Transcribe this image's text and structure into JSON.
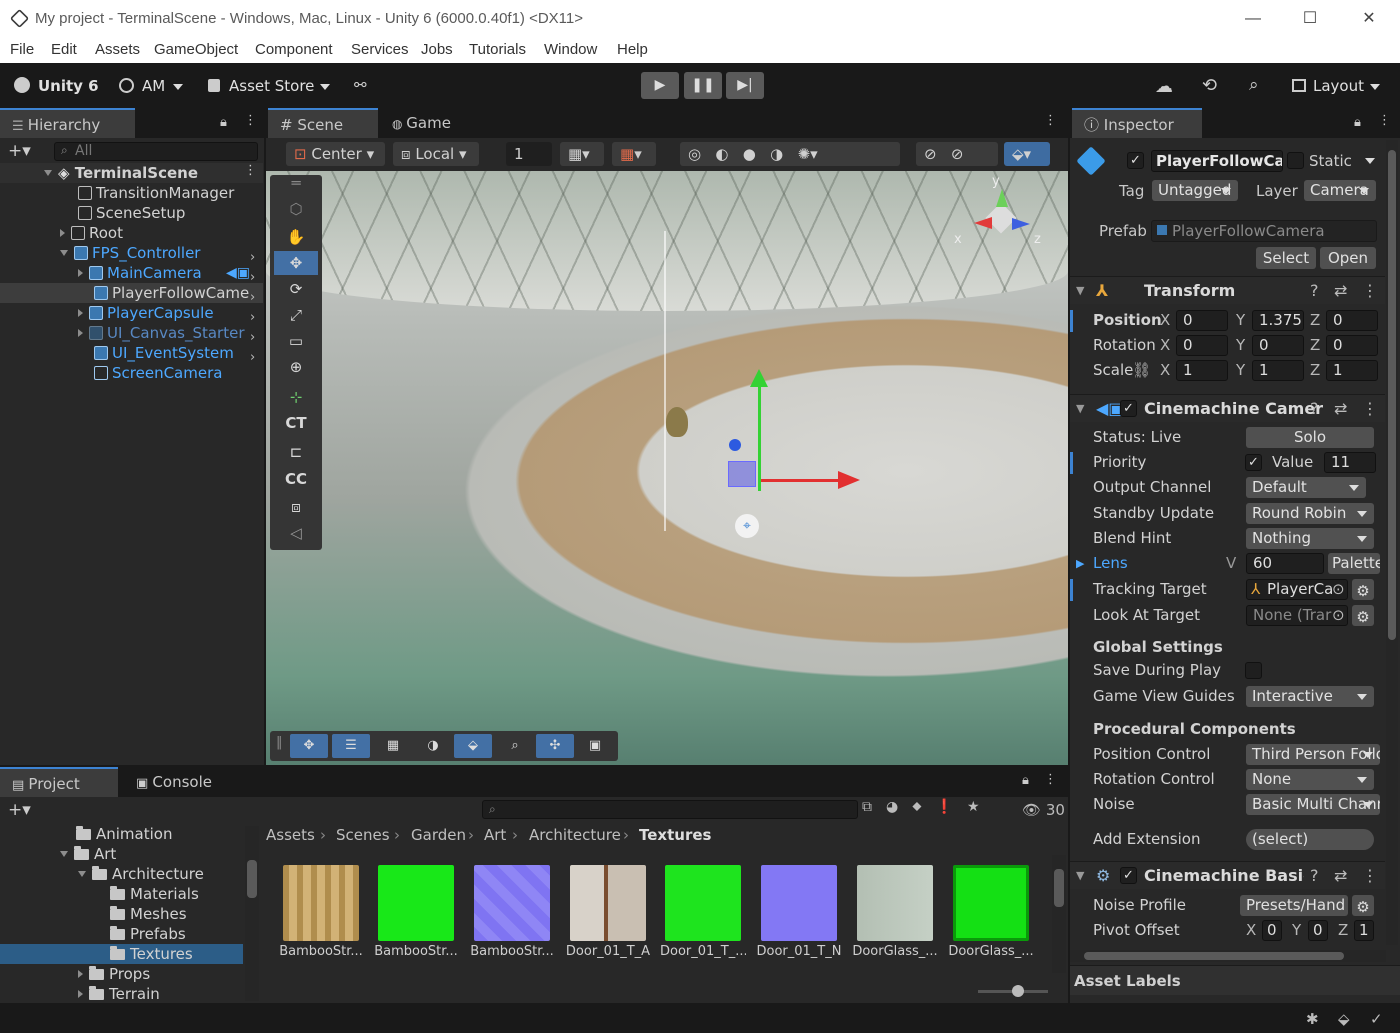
{
  "window": {
    "title": "My project - TerminalScene - Windows, Mac, Linux - Unity 6 (6000.0.40f1) <DX11>"
  },
  "menu": [
    "File",
    "Edit",
    "Assets",
    "GameObject",
    "Component",
    "Services",
    "Jobs",
    "Tutorials",
    "Window",
    "Help"
  ],
  "toolbar": {
    "unity": "Unity 6",
    "account": "AM",
    "asset_store": "Asset Store",
    "layout": "Layout"
  },
  "hierarchy": {
    "tab": "Hierarchy",
    "search_placeholder": "All",
    "scene": "TerminalScene",
    "items": [
      "TransitionManager",
      "SceneSetup",
      "Root",
      "FPS_Controller",
      "MainCamera",
      "PlayerFollowCame",
      "PlayerCapsule",
      "UI_Canvas_Starter",
      "UI_EventSystem",
      "ScreenCamera"
    ]
  },
  "scene_view": {
    "tab_scene": "Scene",
    "tab_game": "Game",
    "pivot": "Center",
    "space": "Local",
    "snap_value": "1",
    "tool_ct": "CT",
    "tool_cc": "CC",
    "gizmo_y": "y",
    "gizmo_x": "x",
    "gizmo_z": "z"
  },
  "inspector": {
    "tab": "Inspector",
    "object_name": "PlayerFollowCa",
    "static_label": "Static",
    "tag_label": "Tag",
    "tag_value": "Untagged",
    "layer_label": "Layer",
    "layer_value": "Camera",
    "prefab_label": "Prefab",
    "prefab_value": "PlayerFollowCamera",
    "select_btn": "Select",
    "open_btn": "Open",
    "transform": {
      "title": "Transform",
      "position": "Position",
      "rotation": "Rotation",
      "scale": "Scale",
      "pos": [
        "0",
        "1.375",
        "0"
      ],
      "rot": [
        "0",
        "0",
        "0"
      ],
      "scl": [
        "1",
        "1",
        "1"
      ]
    },
    "cine_camera": {
      "title": "Cinemachine Camer",
      "status": "Status: Live",
      "solo": "Solo",
      "priority": "Priority",
      "value_label": "Value",
      "priority_value": "11",
      "output_channel": "Output Channel",
      "output_value": "Default",
      "standby": "Standby Update",
      "standby_value": "Round Robin",
      "blend_hint": "Blend Hint",
      "blend_value": "Nothing",
      "lens": "Lens",
      "lens_v": "V",
      "lens_value": "60",
      "palette": "Palette",
      "tracking": "Tracking Target",
      "tracking_value": "PlayerCa",
      "look_at": "Look At Target",
      "look_at_value": "None (Trar",
      "global_settings": "Global Settings",
      "save_play": "Save During Play",
      "guides": "Game View Guides",
      "guides_value": "Interactive",
      "procedural": "Procedural Components",
      "pos_control": "Position Control",
      "pos_control_value": "Third Person Follo",
      "rot_control": "Rotation Control",
      "rot_control_value": "None",
      "noise": "Noise",
      "noise_value": "Basic Multi Chann",
      "add_ext": "Add Extension",
      "add_ext_value": "(select)"
    },
    "cine_basic": {
      "title": "Cinemachine Basic I",
      "noise_profile": "Noise Profile",
      "noise_profile_value": "Presets/Hand",
      "pivot_offset": "Pivot Offset",
      "pivot": [
        "0",
        "0",
        "1"
      ]
    },
    "asset_labels": "Asset Labels"
  },
  "project": {
    "tab_project": "Project",
    "tab_console": "Console",
    "count": "30",
    "tree": [
      "Animation",
      "Art",
      "Architecture",
      "Materials",
      "Meshes",
      "Prefabs",
      "Textures",
      "Props",
      "Terrain"
    ],
    "breadcrumb": [
      "Assets",
      "Scenes",
      "Garden",
      "Art",
      "Architecture",
      "Textures"
    ],
    "assets": [
      "BambooStr...",
      "BambooStr...",
      "BambooStr...",
      "Door_01_T_A",
      "Door_01_T_...",
      "Door_01_T_N",
      "DoorGlass_...",
      "DoorGlass_..."
    ]
  }
}
